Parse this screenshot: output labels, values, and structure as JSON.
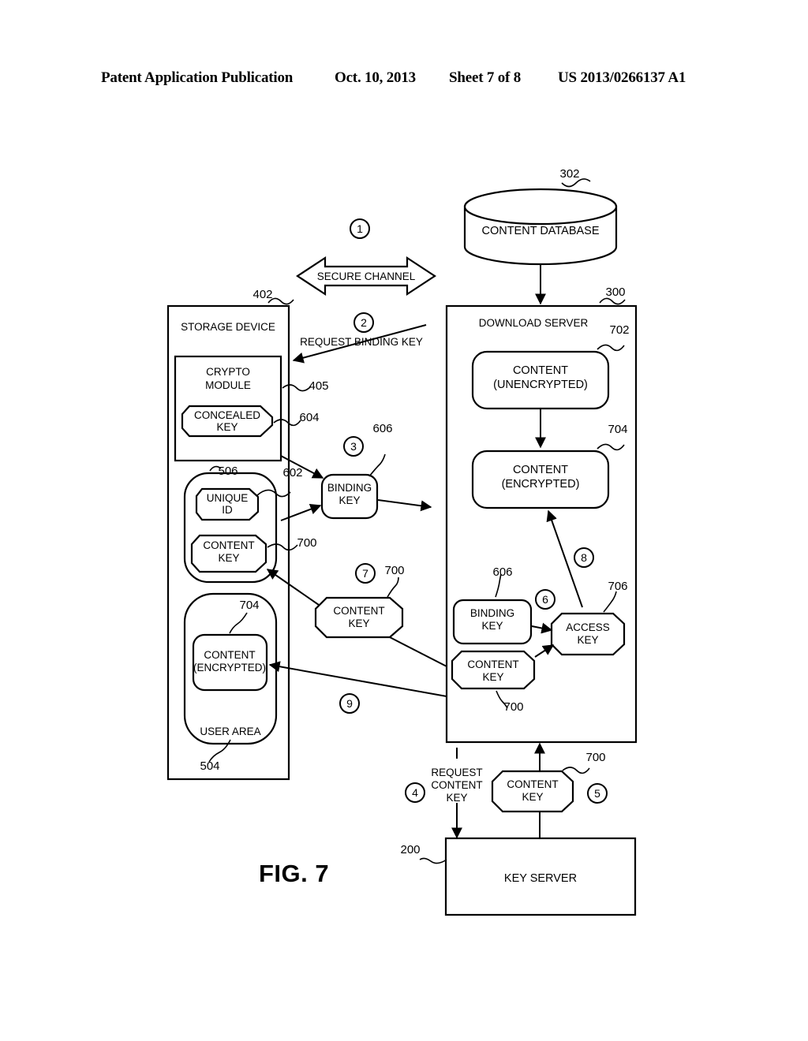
{
  "header": {
    "publication": "Patent Application Publication",
    "date": "Oct. 10, 2013",
    "sheet": "Sheet 7 of 8",
    "patent_number": "US 2013/0266137 A1"
  },
  "figure": {
    "label": "FIG. 7"
  },
  "nodes": {
    "content_database": {
      "label": "CONTENT DATABASE",
      "ref": "302"
    },
    "secure_channel": {
      "label": "SECURE CHANNEL",
      "step": "1"
    },
    "storage_device": {
      "label": "STORAGE DEVICE",
      "ref": "402"
    },
    "crypto_module": {
      "label_line1": "CRYPTO",
      "label_line2": "MODULE",
      "ref": "405"
    },
    "concealed_key": {
      "label_line1": "CONCEALED",
      "label_line2": "KEY",
      "ref": "604"
    },
    "secure_area": {
      "ref": "506"
    },
    "unique_id": {
      "label_line1": "UNIQUE",
      "label_line2": "ID",
      "ref": "602"
    },
    "content_key_device": {
      "label_line1": "CONTENT",
      "label_line2": "KEY",
      "ref": "700"
    },
    "user_area": {
      "label": "USER AREA",
      "ref": "504"
    },
    "content_encrypted_device": {
      "label_line1": "CONTENT",
      "label_line2": "(ENCRYPTED)",
      "ref": "704"
    },
    "binding_key_mid": {
      "label_line1": "BINDING",
      "label_line2": "KEY",
      "ref": "606",
      "step": "3"
    },
    "content_key_mid": {
      "label_line1": "CONTENT",
      "label_line2": "KEY",
      "ref": "700",
      "step": "7"
    },
    "download_server": {
      "label": "DOWNLOAD SERVER",
      "ref": "300"
    },
    "content_unencrypted": {
      "label_line1": "CONTENT",
      "label_line2": "(UNENCRYPTED)",
      "ref": "702"
    },
    "content_encrypted_server": {
      "label_line1": "CONTENT",
      "label_line2": "(ENCRYPTED)",
      "ref": "704"
    },
    "binding_key_server": {
      "label_line1": "BINDING",
      "label_line2": "KEY",
      "ref": "606"
    },
    "content_key_server": {
      "label_line1": "CONTENT",
      "label_line2": "KEY",
      "ref": "700"
    },
    "access_key": {
      "label_line1": "ACCESS",
      "label_line2": "KEY",
      "ref": "706",
      "step": "6"
    },
    "content_key_request": {
      "label_line1": "CONTENT",
      "label_line2": "KEY",
      "ref": "700",
      "step": "5"
    },
    "key_server": {
      "label": "KEY SERVER",
      "ref": "200"
    }
  },
  "edges": {
    "request_binding_key": {
      "label": "REQUEST BINDING KEY",
      "step": "2"
    },
    "request_content_key": {
      "label_line1": "REQUEST",
      "label_line2": "CONTENT",
      "label_line3": "KEY",
      "step": "4"
    },
    "deliver_access_key": {
      "step": "8"
    },
    "deliver_content": {
      "step": "9"
    }
  },
  "colors": {
    "stroke": "#000000",
    "fill": "#ffffff"
  }
}
